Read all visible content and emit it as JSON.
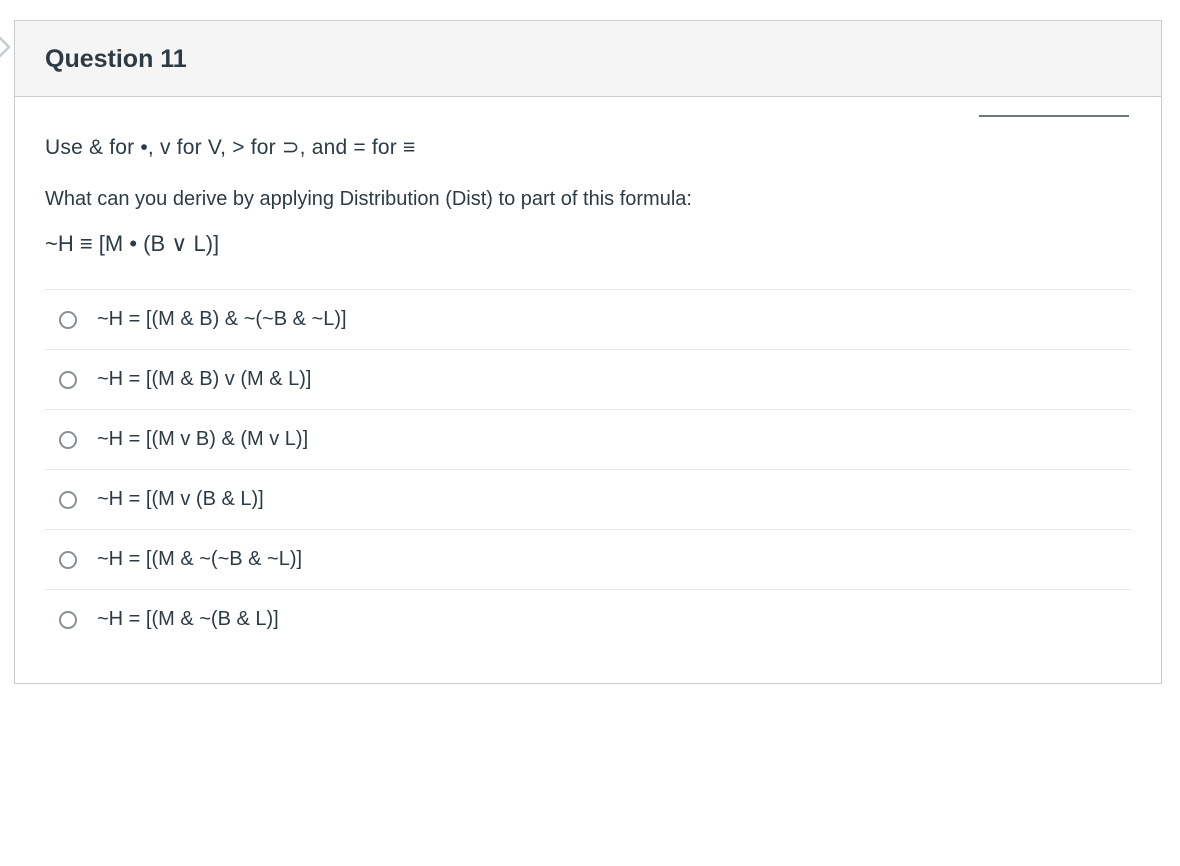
{
  "question": {
    "title": "Question 11",
    "instruction": "Use  & for •,  v for V,  > for ⊃, and  = for ≡",
    "prompt": "What can you derive by applying Distribution (Dist) to part of this formula:",
    "formula": "~H ≡ [M • (B ∨ L)]",
    "options": [
      "~H = [(M & B) & ~(~B & ~L)]",
      "~H = [(M & B) v (M & L)]",
      "~H = [(M v B) & (M v L)]",
      "~H = [(M v (B & L)]",
      "~H = [(M & ~(~B & ~L)]",
      "~H = [(M & ~(B & L)]"
    ]
  }
}
